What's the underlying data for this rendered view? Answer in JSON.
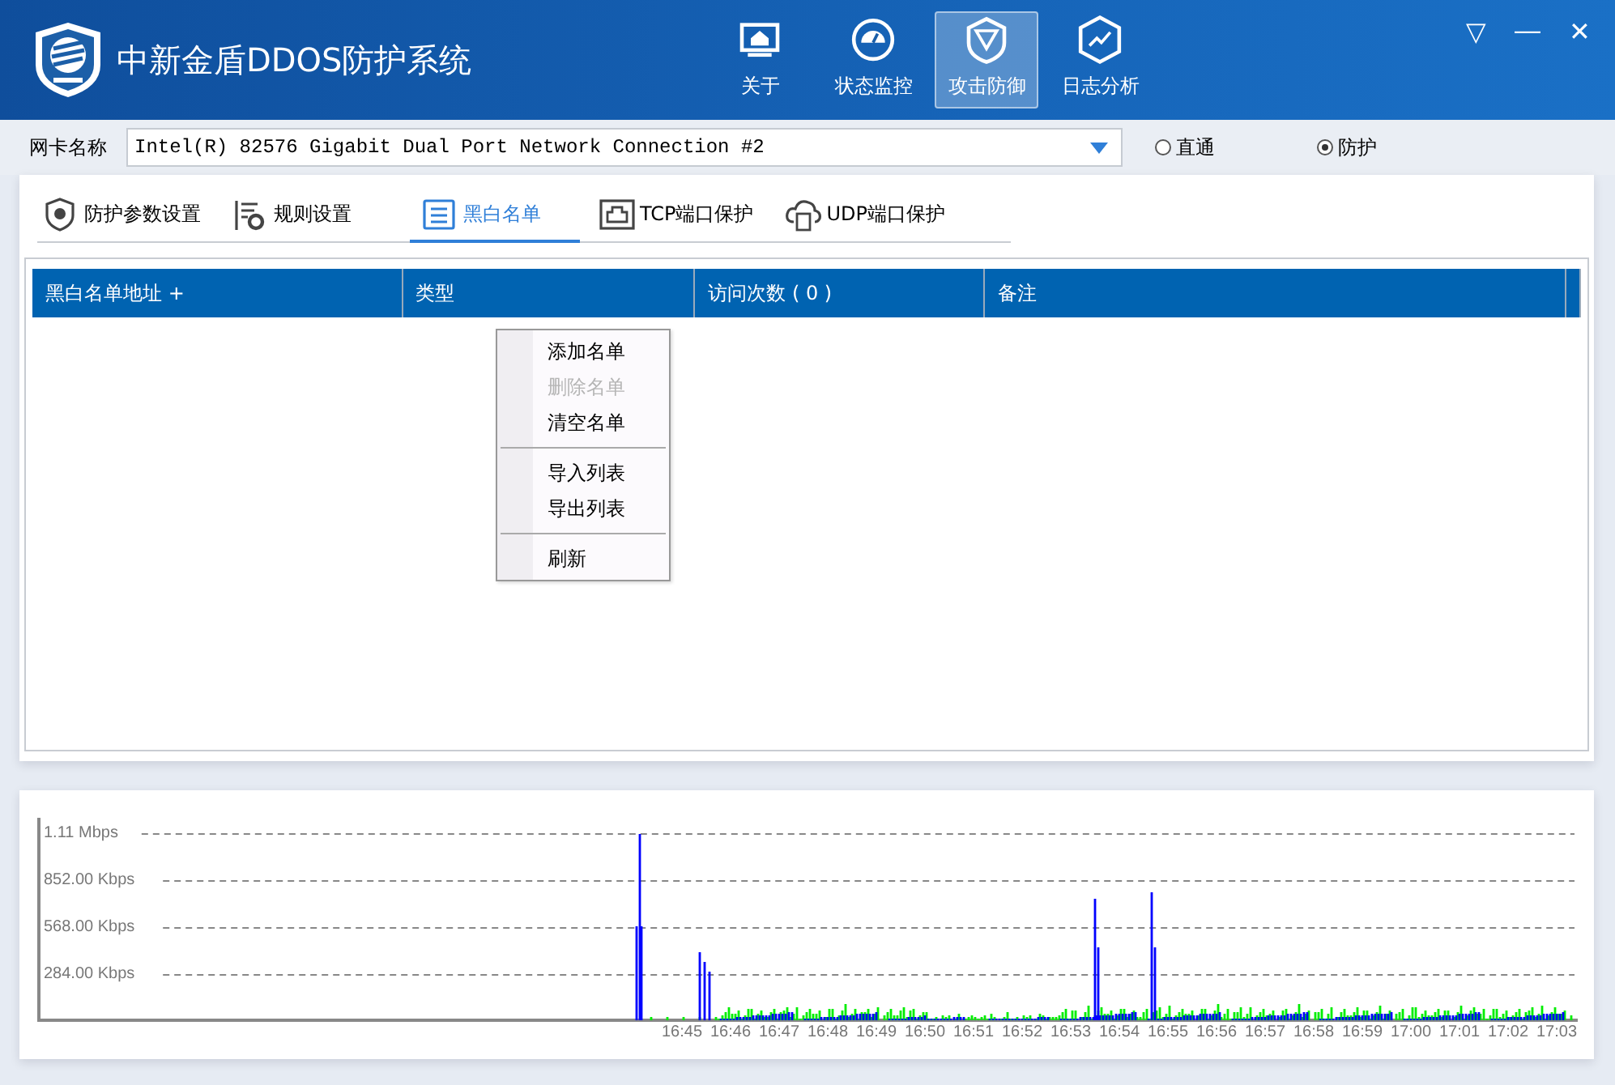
{
  "window": {
    "title": "中新金盾DDOS防护系统",
    "controls": [
      "▽",
      "—",
      "✕"
    ]
  },
  "nav": [
    {
      "label": "关于",
      "selected": false
    },
    {
      "label": "状态监控",
      "selected": false
    },
    {
      "label": "攻击防御",
      "selected": true
    },
    {
      "label": "日志分析",
      "selected": false
    }
  ],
  "adapter": {
    "label": "网卡名称",
    "value": "Intel(R) 82576 Gigabit Dual Port Network Connection #2"
  },
  "modes": [
    {
      "label": "直通",
      "selected": false
    },
    {
      "label": "防护",
      "selected": true
    }
  ],
  "tabs": [
    {
      "label": "防护参数设置",
      "selected": false
    },
    {
      "label": "规则设置",
      "selected": false
    },
    {
      "label": "黑白名单",
      "selected": true
    },
    {
      "label": "TCP端口保护",
      "selected": false
    },
    {
      "label": "UDP端口保护",
      "selected": false
    }
  ],
  "table": {
    "columns": [
      "黑白名单地址 +",
      "类型",
      "访问次数 ( 0 )",
      "备注"
    ]
  },
  "context_menu": [
    {
      "kind": "item",
      "label": "添加名单",
      "disabled": false
    },
    {
      "kind": "item",
      "label": "删除名单",
      "disabled": true
    },
    {
      "kind": "item",
      "label": "清空名单",
      "disabled": false
    },
    {
      "kind": "separator"
    },
    {
      "kind": "item",
      "label": "导入列表",
      "disabled": false
    },
    {
      "kind": "item",
      "label": "导出列表",
      "disabled": false
    },
    {
      "kind": "separator"
    },
    {
      "kind": "item",
      "label": "刷新",
      "disabled": false
    }
  ],
  "traffic_graph": {
    "y_labels": [
      "1.11 Mbps",
      "852.00 Kbps",
      "568.00 Kbps",
      "284.00 Kbps"
    ],
    "x_labels": [
      "16:45",
      "16:46",
      "16:47",
      "16:48",
      "16:49",
      "16:50",
      "16:51",
      "16:52",
      "16:53",
      "16:54",
      "16:55",
      "16:56",
      "16:57",
      "16:58",
      "16:59",
      "17:00",
      "17:01",
      "17:02",
      "17:03"
    ]
  }
}
